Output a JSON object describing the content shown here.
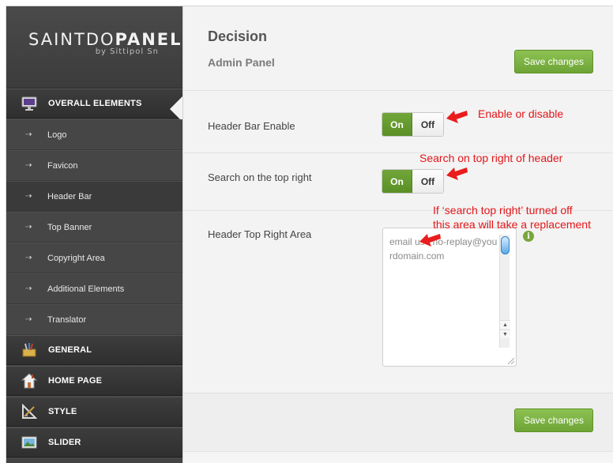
{
  "brand": {
    "title_light": "SAINTDO",
    "title_bold": "PANEL",
    "byline": "by Sittipol Sn"
  },
  "sidebar": {
    "active_category": {
      "label": "OVERALL ELEMENTS",
      "icon": "monitor-icon"
    },
    "sub_items": [
      {
        "label": "Logo"
      },
      {
        "label": "Favicon"
      },
      {
        "label": "Header Bar",
        "active": true
      },
      {
        "label": "Top Banner"
      },
      {
        "label": "Copyright Area"
      },
      {
        "label": "Additional Elements"
      },
      {
        "label": "Translator"
      }
    ],
    "categories": [
      {
        "label": "GENERAL",
        "icon": "tools-icon"
      },
      {
        "label": "HOME PAGE",
        "icon": "house-icon"
      },
      {
        "label": "STYLE",
        "icon": "ruler-icon"
      },
      {
        "label": "SLIDER",
        "icon": "picture-icon"
      }
    ],
    "sub_arrow": "⇢"
  },
  "main": {
    "title": "Decision",
    "subtitle": "Admin Panel",
    "save_label": "Save changes",
    "save_label_bottom": "Save changes",
    "settings": {
      "header_bar_enable": {
        "label": "Header Bar Enable",
        "on_label": "On",
        "off_label": "Off",
        "selected": "On"
      },
      "search_top_right": {
        "label": "Search on the top right",
        "on_label": "On",
        "off_label": "Off",
        "selected": "On"
      },
      "header_top_right_area": {
        "label": "Header Top Right Area",
        "value": "email us : no-replay@yourdomain.com"
      }
    }
  },
  "annotations": {
    "enable_disable": "Enable or disable",
    "search_note": "Search on top right of header",
    "replacement_line1": "If ‘search top right’ turned off",
    "replacement_line2": "this area will take a replacement"
  },
  "colors": {
    "accent_green": "#6ea436",
    "annotation_red": "#e4161a",
    "sidebar_bg": "#444444"
  }
}
